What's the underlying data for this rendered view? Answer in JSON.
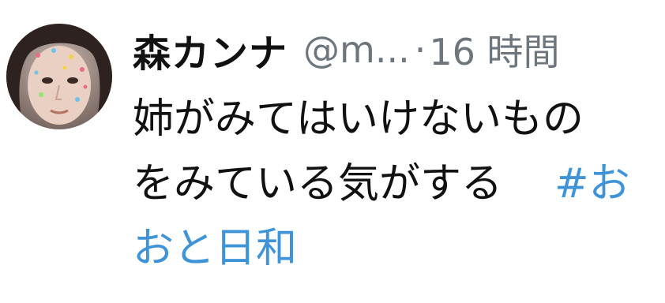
{
  "tweet": {
    "display_name": "森カンナ",
    "handle": "@m...",
    "separator": "·",
    "time": "16 時間",
    "body_line1": "姉がみてはいけないもの",
    "body_line2": "をみている気がする",
    "hashtag_part1": "#お",
    "hashtag_part2": "おと日和"
  },
  "colors": {
    "text": "#111111",
    "muted": "#6e767d",
    "link": "#3f94d8"
  }
}
